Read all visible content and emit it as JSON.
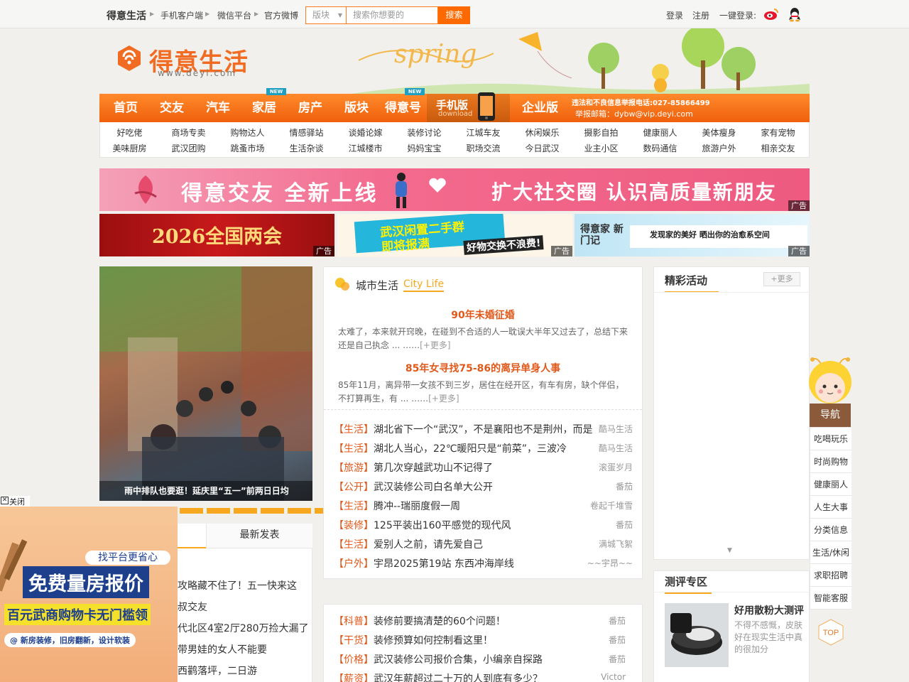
{
  "topbar": {
    "brand": "得意生活",
    "links": [
      "手机客户端",
      "微信平台",
      "官方微博"
    ],
    "search_select": "版块",
    "search_placeholder": "搜索你想要的",
    "search_button": "搜索",
    "login": "登录",
    "register": "注册",
    "onekey": "一键登录:",
    "icons": [
      "weibo-icon",
      "qq-icon"
    ]
  },
  "logo": {
    "name": "得意生活",
    "url": "www.deyi.com",
    "banner_text": "spring"
  },
  "nav": {
    "items": [
      "首页",
      "交友",
      "汽车",
      "家居",
      "房产",
      "版块",
      "得意号",
      "企业版"
    ],
    "new_badge": "NEW",
    "mobile_label": "手机版",
    "mobile_sub": "download",
    "report_phone": "违法和不良信息举报电话:027-85866499",
    "report_email": "举报邮箱：dybw@vip.deyi.com"
  },
  "subnav": {
    "row1": [
      "好吃佬",
      "商场专卖",
      "购物达人",
      "情感驿站",
      "谈婚论嫁",
      "装修讨论",
      "江城车友",
      "休闲娱乐",
      "摄影自拍",
      "健康丽人",
      "美体瘦身",
      "家有宠物"
    ],
    "row2": [
      "美味厨房",
      "武汉团购",
      "跳蚤市场",
      "生活杂谈",
      "江城楼市",
      "妈妈宝宝",
      "职场交流",
      "今日武汉",
      "业主小区",
      "数码通信",
      "旅游户外",
      "相亲交友"
    ]
  },
  "banners": {
    "ad_label": "广告",
    "main_left": "得意交友  全新上线",
    "main_right": "扩大社交圈  认识高质量新朋友",
    "small1": "2026全国两会",
    "small2_line1": "武汉闲置二手群",
    "small2_line2": "即将报满",
    "small2_line3": "好物交换不浪费!",
    "small3_logo": "得意家 新门记",
    "small3_text": "发现家的美好 晒出你的治愈系空间"
  },
  "photo": {
    "caption": "雨中排队也要逛！延庆里“五一”前两日日均"
  },
  "tabs": {
    "latest": "最新发表"
  },
  "left_list": [
    "攻略藏不住了！五一快来这",
    "叔交友",
    "代北区4室2厅280万捡大漏了",
    "带男娃的女人不能要",
    "西鹳落坪，二日游"
  ],
  "city": {
    "title": "城市生活",
    "title_en": "City Life",
    "features": [
      {
        "title": "90年未婚征婚",
        "desc": "太难了，本来就开窍晚，在碰到不合适的人一耽误大半年又过去了，总结下来还是自己执念 ... ……",
        "more": "[+更多]"
      },
      {
        "title": "85年女寻找75-86的离异单身人事",
        "desc": "85年11月，离异带一女孩不到三岁，居住在经开区，有车有房，缺个伴侣，不打算再生，有 ... ……",
        "more": "[+更多]"
      }
    ],
    "list": [
      {
        "cat": "【生活】",
        "title": "湖北省下一个“武汉”，不是襄阳也不是荆州，而是",
        "author": "酷马生活"
      },
      {
        "cat": "【生活】",
        "title": "湖北人当心，22℃暖阳只是“前菜”，三波冷",
        "author": "酷马生活"
      },
      {
        "cat": "【旅游】",
        "title": "第几次穿越武功山不记得了",
        "author": "滚蛋岁月"
      },
      {
        "cat": "【公开】",
        "title": "武汉装修公司白名单大公开",
        "author": "番茄"
      },
      {
        "cat": "【生活】",
        "title": "腾冲--瑞丽度假一周",
        "author": "卷起千堆雪"
      },
      {
        "cat": "【装修】",
        "title": "125平装出160平感觉的现代风",
        "author": "番茄"
      },
      {
        "cat": "【生活】",
        "title": "爱别人之前，请先爱自己",
        "author": "满城飞絮"
      },
      {
        "cat": "【户外】",
        "title": "宇昂2025第19站 东西冲海岸线",
        "author": "~~宇昂~~"
      }
    ],
    "list2": [
      {
        "cat": "【科普】",
        "title": "装修前要搞清楚的60个问题！",
        "author": "番茄"
      },
      {
        "cat": "【干货】",
        "title": "装修预算如何控制看这里！",
        "author": "番茄"
      },
      {
        "cat": "【价格】",
        "title": "武汉装修公司报价合集，小编亲自探路",
        "author": "番茄"
      },
      {
        "cat": "【薪资】",
        "title": "武汉年薪超过二十万的人到底有多少？",
        "author": "Victor"
      }
    ]
  },
  "activities": {
    "title": "精彩活动",
    "more": "+更多"
  },
  "review": {
    "title": "测评专区",
    "item_title": "好用散粉大测评",
    "item_desc": "不得不感慨，皮肤好在现实生活中真的很加分"
  },
  "side_nav": {
    "title": "导航",
    "items": [
      "吃喝玩乐",
      "时尚购物",
      "健康丽人",
      "人生大事",
      "分类信息",
      "生活/休闲",
      "求职招聘",
      "智能客服"
    ],
    "top": "TOP"
  },
  "float_ad": {
    "close": "关闭",
    "line1": "找平台更省心",
    "line2": "免费量房报价",
    "line3": "百元武商购物卡无门槛领",
    "line4": "新房装修，旧房翻新，设计软装"
  }
}
